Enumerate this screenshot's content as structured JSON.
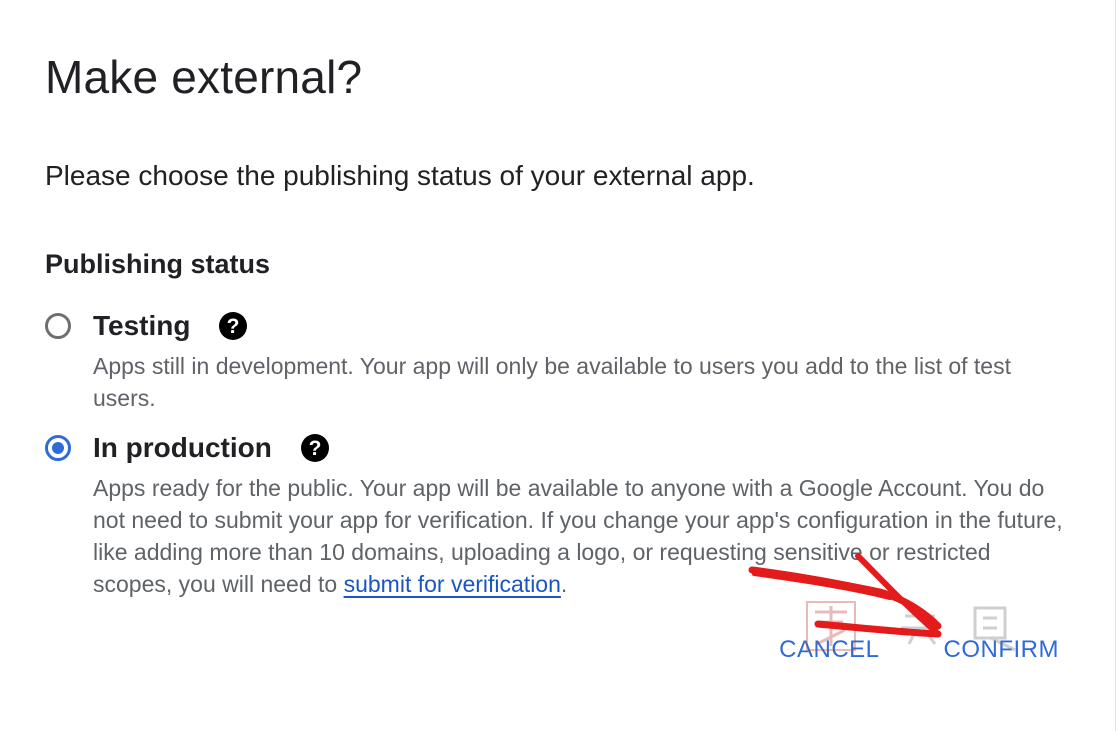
{
  "dialog": {
    "title": "Make external?",
    "intro": "Please choose the publishing status of your external app.",
    "section_heading": "Publishing status",
    "options": [
      {
        "label": "Testing",
        "selected": false,
        "description": "Apps still in development. Your app will only be available to users you add to the list of test users.",
        "help_icon": "help-icon"
      },
      {
        "label": "In production",
        "selected": true,
        "description_before_link": "Apps ready for the public. Your app will be available to anyone with a Google Account. You do not need to submit your app for verification. If you change your app's configuration in the future, like adding more than 10 domains, uploading a logo, or requesting sensitive or restricted scopes, you will need to ",
        "link_text": "submit for verification",
        "description_after_link": ".",
        "help_icon": "help-icon"
      }
    ],
    "actions": {
      "cancel_label": "CANCEL",
      "confirm_label": "CONFIRM"
    }
  },
  "colors": {
    "accent": "#2f6bd8",
    "text_primary": "#202124",
    "text_secondary": "#5f6368",
    "annotation": "#e31b1b"
  }
}
